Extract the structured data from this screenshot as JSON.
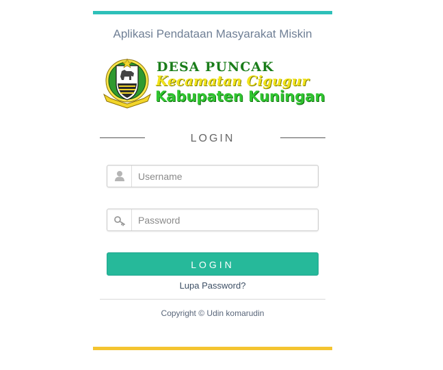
{
  "header": {
    "app_title": "Aplikasi Pendataan Masyarakat Miskin"
  },
  "logo": {
    "line1": "DESA PUNCAK",
    "line2": "Kecamatan Cigugur",
    "line3": "Kabupaten Kuningan",
    "icon": "regency-emblem-icon"
  },
  "login": {
    "heading": "LOGIN",
    "username_placeholder": "Username",
    "username_value": "",
    "username_icon": "user-icon",
    "password_placeholder": "Password",
    "password_value": "",
    "password_icon": "key-icon",
    "submit_label": "LOGIN",
    "forgot_label": "Lupa Password?"
  },
  "footer": {
    "copyright": "Copyright © Udin komarudin"
  },
  "colors": {
    "top_bar": "#2ec0b9",
    "bottom_bar": "#f4c430",
    "button": "#26b99a",
    "title_text": "#6f7f95"
  }
}
